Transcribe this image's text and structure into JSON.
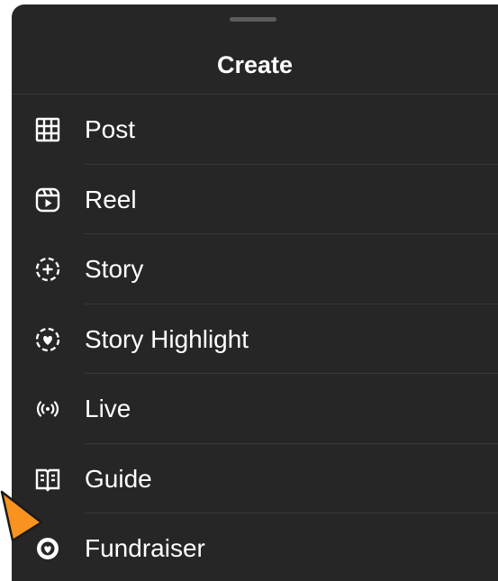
{
  "sheet": {
    "title": "Create",
    "items": [
      {
        "label": "Post",
        "icon": "grid-icon"
      },
      {
        "label": "Reel",
        "icon": "reel-icon"
      },
      {
        "label": "Story",
        "icon": "story-add-icon"
      },
      {
        "label": "Story Highlight",
        "icon": "story-highlight-icon"
      },
      {
        "label": "Live",
        "icon": "live-icon"
      },
      {
        "label": "Guide",
        "icon": "guide-icon"
      },
      {
        "label": "Fundraiser",
        "icon": "fundraiser-icon"
      }
    ]
  },
  "colors": {
    "background": "#262626",
    "text": "#ffffff",
    "divider": "#383838",
    "handle": "#5c5c5c",
    "pointer": "#f7931e"
  }
}
